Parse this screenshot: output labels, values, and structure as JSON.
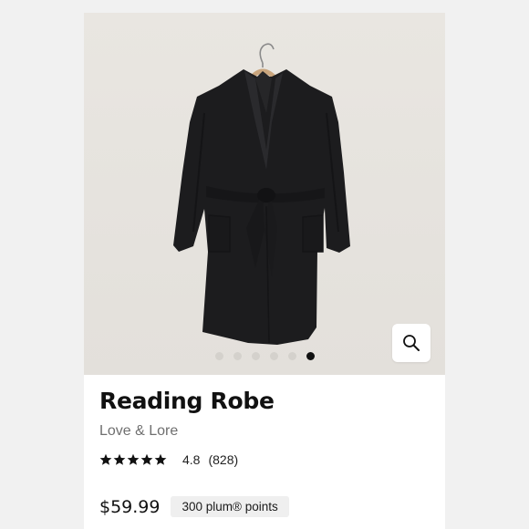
{
  "product": {
    "title": "Reading Robe",
    "brand": "Love & Lore",
    "rating_value": "4.8",
    "review_count": "(828)",
    "stars": 5,
    "price": "$59.99",
    "points_badge": "300 plum® points"
  },
  "gallery": {
    "image_count": 6,
    "active_index": 5,
    "zoom_icon": "magnifier-icon"
  },
  "colors": {
    "background": "#f1f1f1",
    "hero_bg": "#e6e3de",
    "garment": "#1b1b1d",
    "dot_inactive": "#d4d1cc",
    "dot_active": "#111111"
  }
}
